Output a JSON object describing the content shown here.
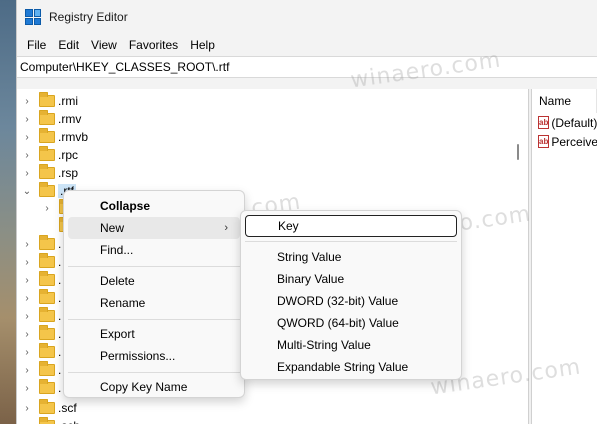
{
  "window": {
    "title": "Registry Editor",
    "menu": [
      "File",
      "Edit",
      "View",
      "Favorites",
      "Help"
    ],
    "address": "Computer\\HKEY_CLASSES_ROOT\\.rtf"
  },
  "tree": {
    "rows": [
      {
        "label": ".rmi",
        "expanded": false
      },
      {
        "label": ".rmv",
        "expanded": false
      },
      {
        "label": ".rmvb",
        "expanded": false
      },
      {
        "label": ".rpc",
        "expanded": false
      },
      {
        "label": ".rsp",
        "expanded": false
      },
      {
        "label": ".rtf",
        "expanded": true,
        "selected": true
      },
      {
        "label": "",
        "expanded": false
      },
      {
        "label": "",
        "expanded": false
      },
      {
        "label": ".",
        "expanded": false
      },
      {
        "label": ".",
        "expanded": false
      },
      {
        "label": ".",
        "expanded": false
      },
      {
        "label": ".",
        "expanded": false
      },
      {
        "label": ".",
        "expanded": false
      },
      {
        "label": ".",
        "expanded": false
      },
      {
        "label": ".",
        "expanded": false
      },
      {
        "label": ".",
        "expanded": false
      },
      {
        "label": ".",
        "expanded": false
      },
      {
        "label": ".scf",
        "expanded": false
      },
      {
        "label": ".scb",
        "expanded": false
      }
    ]
  },
  "values_pane": {
    "header": "Name",
    "rows": [
      "(Default)",
      "Perceive"
    ]
  },
  "context_menu": {
    "items": [
      {
        "label": "Collapse",
        "bold": true
      },
      {
        "label": "New",
        "submenu": true,
        "hover": true
      },
      {
        "label": "Find..."
      },
      {
        "sep": true
      },
      {
        "label": "Delete"
      },
      {
        "label": "Rename"
      },
      {
        "sep": true
      },
      {
        "label": "Export"
      },
      {
        "label": "Permissions..."
      },
      {
        "sep": true
      },
      {
        "label": "Copy Key Name"
      }
    ]
  },
  "new_submenu": {
    "items": [
      {
        "label": "Key",
        "focused": true
      },
      {
        "sep": true
      },
      {
        "label": "String Value"
      },
      {
        "label": "Binary Value"
      },
      {
        "label": "DWORD (32-bit) Value"
      },
      {
        "label": "QWORD (64-bit) Value"
      },
      {
        "label": "Multi-String Value"
      },
      {
        "label": "Expandable String Value"
      }
    ]
  },
  "watermark": "winaero.com",
  "icons": {
    "app": "registry-editor-icon",
    "folder": "folder-icon",
    "chevron_right": "chevron-right-icon",
    "chevron_down": "chevron-down-icon",
    "string_value": "string-value-icon",
    "submenu_arrow": "chevron-right-icon"
  }
}
